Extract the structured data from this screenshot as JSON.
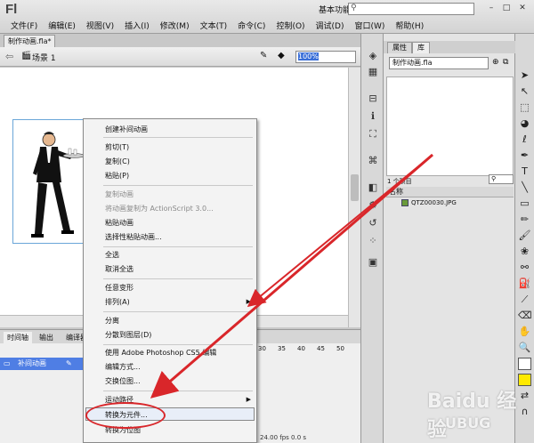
{
  "app": {
    "logo": "Fl"
  },
  "menu": [
    "文件(F)",
    "编辑(E)",
    "视图(V)",
    "插入(I)",
    "修改(M)",
    "文本(T)",
    "命令(C)",
    "控制(O)",
    "调试(D)",
    "窗口(W)",
    "帮助(H)"
  ],
  "workspace": {
    "label": "基本功能 ▾"
  },
  "search": {
    "placeholder": ""
  },
  "document": {
    "tab": "制作动画.fla*",
    "scene": "场景 1",
    "zoom": "100%"
  },
  "timeline": {
    "tabs": [
      "时间轴",
      "输出",
      "编译器"
    ],
    "layer_name": "补间动画",
    "frame_numbers": [
      "30",
      "35",
      "40",
      "45",
      "50"
    ],
    "fps": "24.00 fps  0.0 s"
  },
  "library": {
    "tabs": [
      "属性",
      "库"
    ],
    "document": "制作动画.fla",
    "count": "1 个项目",
    "column_header": "名称",
    "items": [
      "QTZ00030.JPG"
    ]
  },
  "context_menu": {
    "items": [
      {
        "label": "创建补间动画",
        "disabled": false
      },
      {
        "label": "剪切(T)",
        "disabled": false
      },
      {
        "label": "复制(C)",
        "disabled": false
      },
      {
        "label": "粘贴(P)",
        "disabled": false
      },
      {
        "label": "复制动画",
        "disabled": true
      },
      {
        "label": "将动画复制为 ActionScript 3.0...",
        "disabled": true
      },
      {
        "label": "粘贴动画",
        "disabled": false
      },
      {
        "label": "选择性粘贴动画...",
        "disabled": false
      },
      {
        "label": "全选",
        "disabled": false
      },
      {
        "label": "取消全选",
        "disabled": false
      },
      {
        "label": "任意变形",
        "disabled": false
      },
      {
        "label": "排列(A)",
        "disabled": false
      },
      {
        "label": "分离",
        "disabled": false
      },
      {
        "label": "分散到图层(D)",
        "disabled": false
      },
      {
        "label": "使用 Adobe Photoshop CS5 编辑",
        "disabled": false
      },
      {
        "label": "编辑方式...",
        "disabled": false
      },
      {
        "label": "交换位图...",
        "disabled": false
      },
      {
        "label": "运动路径",
        "disabled": false
      },
      {
        "label": "转换为元件...",
        "disabled": false
      },
      {
        "label": "转换为位图",
        "disabled": false
      }
    ]
  },
  "watermark": {
    "brand": "Baidu 经验",
    "sub": "UBUG"
  },
  "colors": {
    "annotation": "#d9262a",
    "selection": "#4f7ee4"
  }
}
